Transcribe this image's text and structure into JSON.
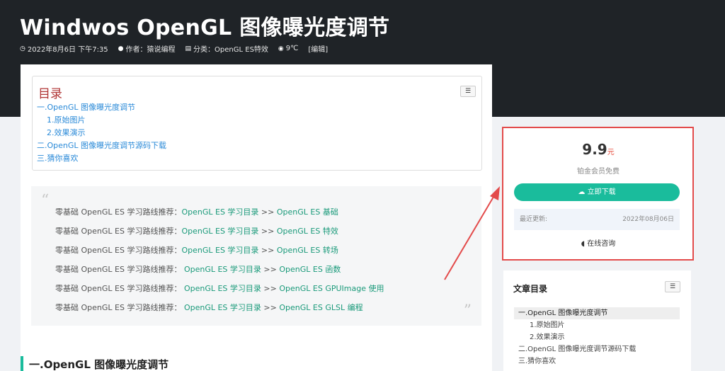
{
  "post": {
    "title": "Windwos OpenGL 图像曝光度调节",
    "meta": {
      "date": "2022年8月6日 下午7:35",
      "author": "作者：猿说编程",
      "category": "分类：OpenGL ES特效",
      "temperature": "9℃",
      "edit": "[编辑]"
    }
  },
  "toc": {
    "title": "目录",
    "items": [
      "一.OpenGL 图像曝光度调节",
      "1.原始图片",
      "2.效果演示",
      "二.OpenGL 图像曝光度调节源码下载",
      "三.猜你喜欢"
    ]
  },
  "quote": {
    "lines": [
      {
        "prefix": "零基础 OpenGL ES 学习路线推荐：",
        "link1": "OpenGL ES 学习目录",
        "sep": " >> ",
        "link2": "OpenGL ES 基础"
      },
      {
        "prefix": "零基础 OpenGL ES 学习路线推荐：",
        "link1": "OpenGL ES 学习目录",
        "sep": "  >> ",
        "link2": "OpenGL ES 特效"
      },
      {
        "prefix": "零基础 OpenGL ES 学习路线推荐：",
        "link1": "OpenGL ES 学习目录",
        "sep": "  >> ",
        "link2": "OpenGL ES 转场"
      },
      {
        "prefix": "零基础 OpenGL ES 学习路线推荐： ",
        "link1": "OpenGL ES 学习目录",
        "sep": " >> ",
        "link2": "OpenGL ES 函数"
      },
      {
        "prefix": "零基础 OpenGL ES 学习路线推荐： ",
        "link1": "OpenGL ES 学习目录",
        "sep": " >> ",
        "link2": "OpenGL ES GPUImage 使用"
      },
      {
        "prefix": "零基础 OpenGL ES 学习路线推荐： ",
        "link1": "OpenGL ES 学习目录",
        "sep": " >> ",
        "link2": "OpenGL ES GLSL 编程"
      }
    ]
  },
  "section": {
    "heading": "一.OpenGL 图像曝光度调节"
  },
  "sidebar": {
    "price_value": "9.9",
    "price_unit": "元",
    "vip_text": "铂金会员免费",
    "download_label": "立即下载",
    "updated_label": "最近更新:",
    "updated_value": "2022年08月06日",
    "consult_label": "在线咨询",
    "toc_title": "文章目录",
    "toc_items": [
      "一.OpenGL 图像曝光度调节",
      "1.原始图片",
      "2.效果演示",
      "二.OpenGL 图像曝光度调节源码下载",
      "三.猜你喜欢"
    ]
  },
  "colors": {
    "accent": "#1abc9c",
    "highlight": "#e34b4b",
    "hero": "#1f2327"
  }
}
